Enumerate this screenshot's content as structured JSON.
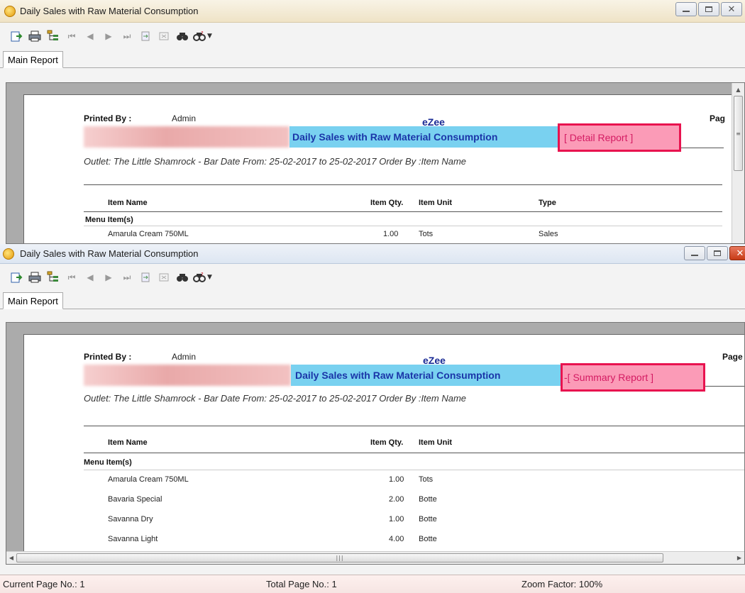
{
  "window_title": "Daily Sales with Raw Material Consumption",
  "tab_label": "Main Report",
  "report": {
    "printed_by_label": "Printed By :",
    "printed_by_value": "Admin",
    "company": "eZee",
    "report_title": "Daily Sales with Raw Material Consumption",
    "outlet_line": "Outlet: The Little Shamrock - Bar Date From: 25-02-2017  to 25-02-2017 Order By :Item Name",
    "page_label_cropped_1": "Pag",
    "page_label_cropped_2": "Page",
    "section_label": "Menu Item(s)",
    "columns": {
      "item_name": "Item Name",
      "item_qty": "Item Qty.",
      "item_unit": "Item Unit",
      "type": "Type"
    }
  },
  "top_window": {
    "mode_label": "[ Detail Report ]",
    "rows": [
      {
        "name": "Amarula Cream 750ML",
        "qty": "1.00",
        "unit": "Tots",
        "type": "Sales"
      }
    ]
  },
  "bottom_window": {
    "mode_label": "-[ Summary Report ]",
    "rows": [
      {
        "name": "Amarula Cream 750ML",
        "qty": "1.00",
        "unit": "Tots"
      },
      {
        "name": "Bavaria Special",
        "qty": "2.00",
        "unit": "Botte"
      },
      {
        "name": "Savanna Dry",
        "qty": "1.00",
        "unit": "Botte"
      },
      {
        "name": "Savanna Light",
        "qty": "4.00",
        "unit": "Botte"
      }
    ]
  },
  "statusbar": {
    "current_page": "Current Page No.: 1",
    "total_page": "Total Page No.: 1",
    "zoom": "Zoom Factor: 100%"
  },
  "icons": [
    "export-icon",
    "print-icon",
    "group-tree-icon",
    "first-page-icon",
    "previous-page-icon",
    "next-page-icon",
    "last-page-icon",
    "goto-page-icon",
    "close-view-icon",
    "search-icon",
    "zoom-icon"
  ],
  "colors": {
    "title_band": "#79d1f0",
    "highlight_border": "#e8134f",
    "highlight_fill": "#fb9bb7",
    "company_blue": "#1a2b95"
  }
}
